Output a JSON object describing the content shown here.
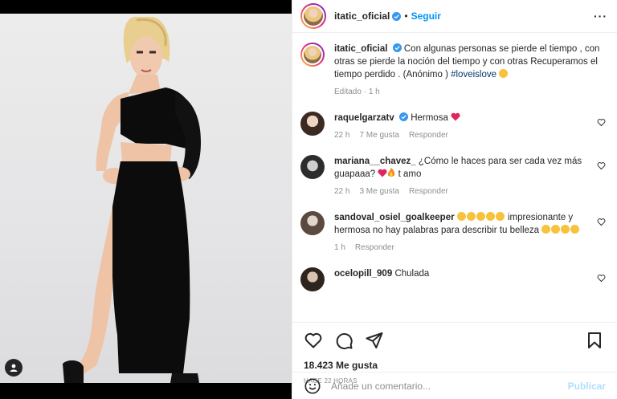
{
  "post": {
    "username": "itatic_oficial",
    "follow_label": "Seguir",
    "caption_text": "Con algunas personas se pierde el tiempo , con otras se pierde la noción del tiempo y con otras Recuperamos el tiempo perdido . (Anónimo ) ",
    "caption_hashtag": "#loveislove",
    "caption_edited": "Editado",
    "caption_age": "1 h"
  },
  "comments": [
    {
      "user": "raquelgarzatv",
      "text": "Hermosa",
      "age": "22 h",
      "likes": "7 Me gusta",
      "reply": "Responder"
    },
    {
      "user": "mariana__chavez_",
      "text": "¿Cómo le haces para ser cada vez más guapaaa? ",
      "text2": " t amo",
      "age": "22 h",
      "likes": "3 Me gusta",
      "reply": "Responder"
    },
    {
      "user": "sandoval_osiel_goalkeeper",
      "text": " impresionante y hermosa no hay palabras para describir tu belleza ",
      "age": "1 h",
      "reply": "Responder"
    },
    {
      "user": "ocelopill_909",
      "text": "Chulada"
    }
  ],
  "actions": {
    "likes": "18.423 Me gusta",
    "time": "HACE 22 HORAS"
  },
  "composer": {
    "placeholder": "Añade un comentario...",
    "publish": "Publicar"
  },
  "colors": {
    "link": "#0095f6",
    "verified": "#3897f0",
    "heart": "#ed4956",
    "muted": "#8e8e8e"
  },
  "icons": [
    "heart-icon",
    "comment-icon",
    "share-icon",
    "bookmark-icon",
    "emoji-icon",
    "more-icon",
    "verified-icon",
    "user-tag-icon"
  ]
}
